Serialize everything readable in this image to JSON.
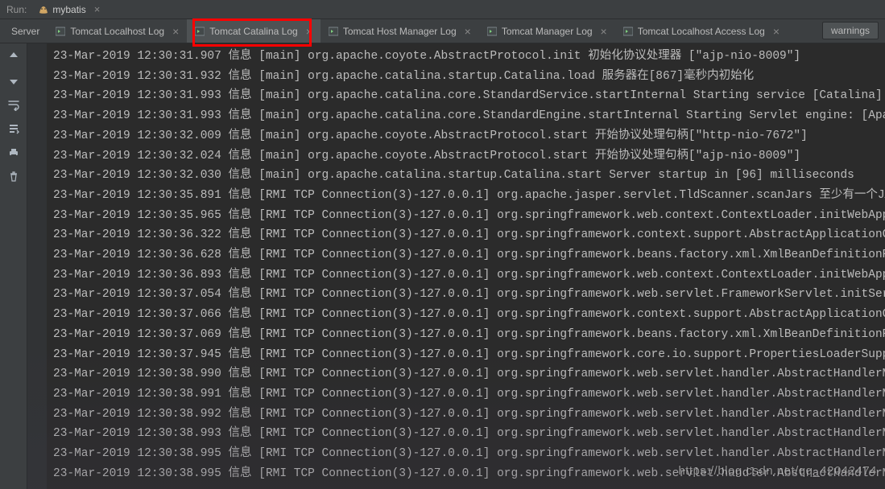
{
  "run": {
    "label": "Run:",
    "config_name": "mybatis"
  },
  "tabs": {
    "server": "Server",
    "items": [
      "Tomcat Localhost Log",
      "Tomcat Catalina Log",
      "Tomcat Host Manager Log",
      "Tomcat Manager Log",
      "Tomcat Localhost Access Log"
    ],
    "selected_index": 1
  },
  "warnings_button": "warnings",
  "icons": {
    "tomcat": "tomcat-icon",
    "console": "console-icon",
    "close": "×",
    "up": "arrow-up-icon",
    "down": "arrow-down-icon",
    "wrap": "soft-wrap-icon",
    "scroll": "scroll-end-icon",
    "print": "print-icon",
    "trash": "trash-icon"
  },
  "log_lines": [
    "23-Mar-2019 12:30:31.907 信息 [main] org.apache.coyote.AbstractProtocol.init 初始化协议处理器 [\"ajp-nio-8009\"]",
    "23-Mar-2019 12:30:31.932 信息 [main] org.apache.catalina.startup.Catalina.load 服务器在[867]毫秒内初始化",
    "23-Mar-2019 12:30:31.993 信息 [main] org.apache.catalina.core.StandardService.startInternal Starting service [Catalina]",
    "23-Mar-2019 12:30:31.993 信息 [main] org.apache.catalina.core.StandardEngine.startInternal Starting Servlet engine: [Apache Tomcat",
    "23-Mar-2019 12:30:32.009 信息 [main] org.apache.coyote.AbstractProtocol.start 开始协议处理句柄[\"http-nio-7672\"]",
    "23-Mar-2019 12:30:32.024 信息 [main] org.apache.coyote.AbstractProtocol.start 开始协议处理句柄[\"ajp-nio-8009\"]",
    "23-Mar-2019 12:30:32.030 信息 [main] org.apache.catalina.startup.Catalina.start Server startup in [96] milliseconds",
    "23-Mar-2019 12:30:35.891 信息 [RMI TCP Connection(3)-127.0.0.1] org.apache.jasper.servlet.TldScanner.scanJars 至少有一个JAR被扫描用",
    "23-Mar-2019 12:30:35.965 信息 [RMI TCP Connection(3)-127.0.0.1] org.springframework.web.context.ContextLoader.initWebApplicationCo",
    "23-Mar-2019 12:30:36.322 信息 [RMI TCP Connection(3)-127.0.0.1] org.springframework.context.support.AbstractApplicationContext.pre",
    "23-Mar-2019 12:30:36.628 信息 [RMI TCP Connection(3)-127.0.0.1] org.springframework.beans.factory.xml.XmlBeanDefinitionReader.load",
    "23-Mar-2019 12:30:36.893 信息 [RMI TCP Connection(3)-127.0.0.1] org.springframework.web.context.ContextLoader.initWebApplicationCo",
    "23-Mar-2019 12:30:37.054 信息 [RMI TCP Connection(3)-127.0.0.1] org.springframework.web.servlet.FrameworkServlet.initServletBean F",
    "23-Mar-2019 12:30:37.066 信息 [RMI TCP Connection(3)-127.0.0.1] org.springframework.context.support.AbstractApplicationContext.pre",
    "23-Mar-2019 12:30:37.069 信息 [RMI TCP Connection(3)-127.0.0.1] org.springframework.beans.factory.xml.XmlBeanDefinitionReader.load",
    "23-Mar-2019 12:30:37.945 信息 [RMI TCP Connection(3)-127.0.0.1] org.springframework.core.io.support.PropertiesLoaderSupport.loadPr",
    "23-Mar-2019 12:30:38.990 信息 [RMI TCP Connection(3)-127.0.0.1] org.springframework.web.servlet.handler.AbstractHandlerMethodMappi",
    "23-Mar-2019 12:30:38.991 信息 [RMI TCP Connection(3)-127.0.0.1] org.springframework.web.servlet.handler.AbstractHandlerMethodMappi",
    "23-Mar-2019 12:30:38.992 信息 [RMI TCP Connection(3)-127.0.0.1] org.springframework.web.servlet.handler.AbstractHandlerMethodMappi",
    "23-Mar-2019 12:30:38.993 信息 [RMI TCP Connection(3)-127.0.0.1] org.springframework.web.servlet.handler.AbstractHandlerMethodMappi",
    "23-Mar-2019 12:30:38.995 信息 [RMI TCP Connection(3)-127.0.0.1] org.springframework.web.servlet.handler.AbstractHandlerMethodMappi",
    "23-Mar-2019 12:30:38.995 信息 [RMI TCP Connection(3)-127.0.0.1] org.springframework.web.servlet.handler.AbstractHandlerMethodMappi"
  ],
  "watermark": "https://blog.csdn.net/qq_42042474"
}
